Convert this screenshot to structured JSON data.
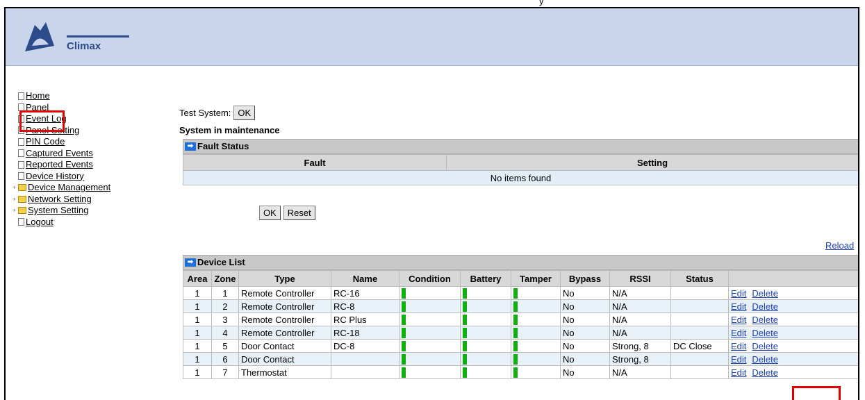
{
  "top_text": "y",
  "logo": {
    "text": "Climax"
  },
  "nav": [
    {
      "label": "Home",
      "type": "doc"
    },
    {
      "label": "Panel",
      "type": "doc"
    },
    {
      "label": "Event Log",
      "type": "doc"
    },
    {
      "label": "Panel Setting",
      "type": "doc"
    },
    {
      "label": "PIN Code",
      "type": "doc"
    },
    {
      "label": "Captured Events",
      "type": "doc"
    },
    {
      "label": "Reported Events",
      "type": "doc"
    },
    {
      "label": "Device History",
      "type": "doc"
    },
    {
      "label": "Device Management",
      "type": "folder"
    },
    {
      "label": "Network Setting",
      "type": "folder"
    },
    {
      "label": "System Setting",
      "type": "folder"
    },
    {
      "label": "Logout",
      "type": "doc"
    }
  ],
  "test_system": {
    "label": "Test System:",
    "button": "OK"
  },
  "maintenance_text": "System in maintenance",
  "fault_status": {
    "title": "Fault Status",
    "columns": [
      "Fault",
      "Setting"
    ],
    "empty_text": "No items found"
  },
  "form_buttons": {
    "ok": "OK",
    "reset": "Reset"
  },
  "reload_label": "Reload",
  "device_list": {
    "title": "Device List",
    "columns": [
      "Area",
      "Zone",
      "Type",
      "Name",
      "Condition",
      "Battery",
      "Tamper",
      "Bypass",
      "RSSI",
      "Status",
      ""
    ],
    "edit_label": "Edit",
    "delete_label": "Delete",
    "rows": [
      {
        "area": "1",
        "zone": "1",
        "type": "Remote Controller",
        "name": "RC-16",
        "bypass": "No",
        "rssi": "N/A",
        "status": ""
      },
      {
        "area": "1",
        "zone": "2",
        "type": "Remote Controller",
        "name": "RC-8",
        "bypass": "No",
        "rssi": "N/A",
        "status": ""
      },
      {
        "area": "1",
        "zone": "3",
        "type": "Remote Controller",
        "name": "RC Plus",
        "bypass": "No",
        "rssi": "N/A",
        "status": ""
      },
      {
        "area": "1",
        "zone": "4",
        "type": "Remote Controller",
        "name": "RC-18",
        "bypass": "No",
        "rssi": "N/A",
        "status": ""
      },
      {
        "area": "1",
        "zone": "5",
        "type": "Door Contact",
        "name": "DC-8",
        "bypass": "No",
        "rssi": "Strong, 8",
        "status": "DC Close"
      },
      {
        "area": "1",
        "zone": "6",
        "type": "Door Contact",
        "name": "",
        "bypass": "No",
        "rssi": "Strong, 8",
        "status": ""
      },
      {
        "area": "1",
        "zone": "7",
        "type": "Thermostat",
        "name": "",
        "bypass": "No",
        "rssi": "N/A",
        "status": ""
      }
    ]
  },
  "colors": {
    "header_bg": "#c9d5ec",
    "highlight": "#e00000",
    "bar_green": "#10b010",
    "link": "#1a3fbf"
  }
}
